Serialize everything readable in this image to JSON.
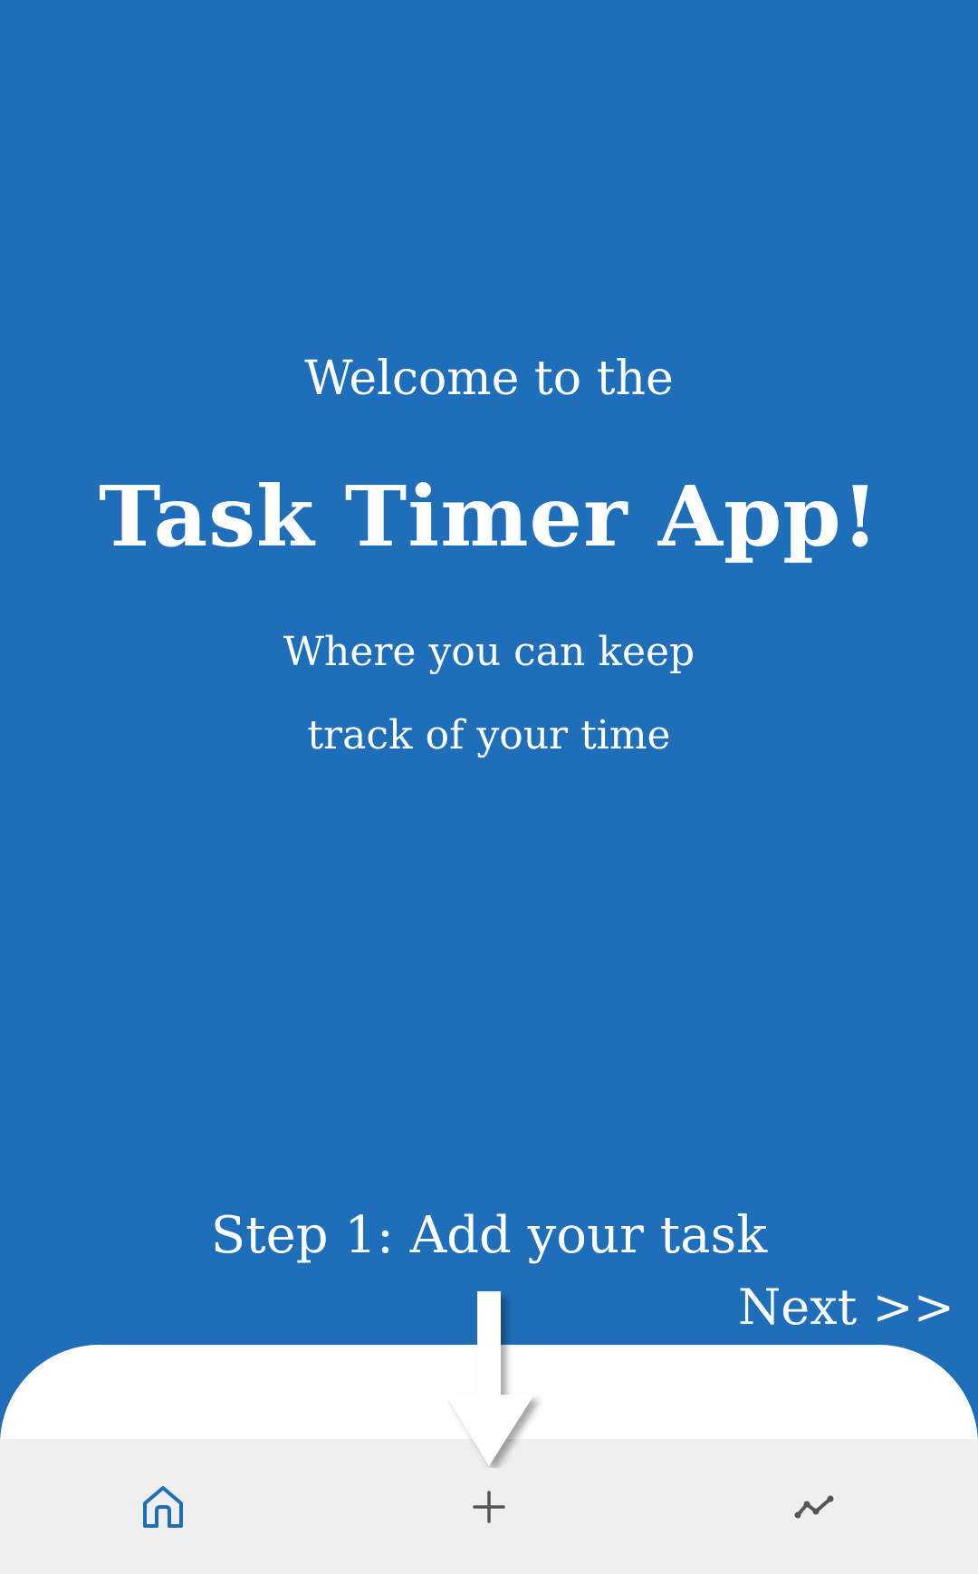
{
  "welcome": {
    "line1": "Welcome to the",
    "title": "Task Timer App!",
    "tagline_line1": "Where you can keep",
    "tagline_line2": "track of your time"
  },
  "onboarding": {
    "step_text": "Step 1: Add your task",
    "next_label": "Next >>"
  },
  "bottom_nav": {
    "items": [
      {
        "icon": "home-icon",
        "active": true
      },
      {
        "icon": "plus-icon",
        "active": false
      },
      {
        "icon": "trend-line-icon",
        "active": false
      }
    ]
  },
  "colors": {
    "background": "#1f6eba",
    "text": "#ffffff",
    "nav_background": "#efefef",
    "home_icon": "#1f6eba",
    "inactive_icon": "#555555"
  }
}
